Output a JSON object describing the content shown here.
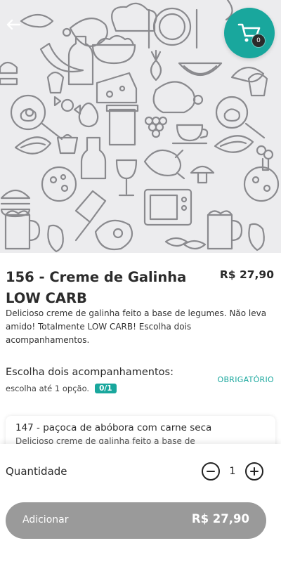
{
  "cart": {
    "count": "0"
  },
  "product": {
    "title": "156 - Creme de Galinha LOW CARB",
    "price": "R$ 27,90",
    "description": "Delicioso creme de galinha feito a base de legumes. Não leva amido! Totalmente LOW CARB! Escolha dois acompanhamentos."
  },
  "choice_section": {
    "title": "Escolha dois acompanhamentos:",
    "subtitle": "escolha até 1 opção.",
    "count": "0/1",
    "required_label": "OBRIGATÓRIO"
  },
  "options": [
    {
      "title": "147 - paçoca de abóbora com carne seca",
      "description": "Delicioso creme de galinha feito a base de"
    }
  ],
  "quantity": {
    "label": "Quantidade",
    "value": "1"
  },
  "add_button": {
    "label": "Adicionar",
    "price": "R$ 27,90"
  },
  "colors": {
    "accent": "#19a79d",
    "hero_bg": "#ececee",
    "button_disabled": "#9a9a9a"
  },
  "icons": [
    "back-arrow-icon",
    "cart-icon",
    "minus-icon",
    "plus-icon"
  ]
}
